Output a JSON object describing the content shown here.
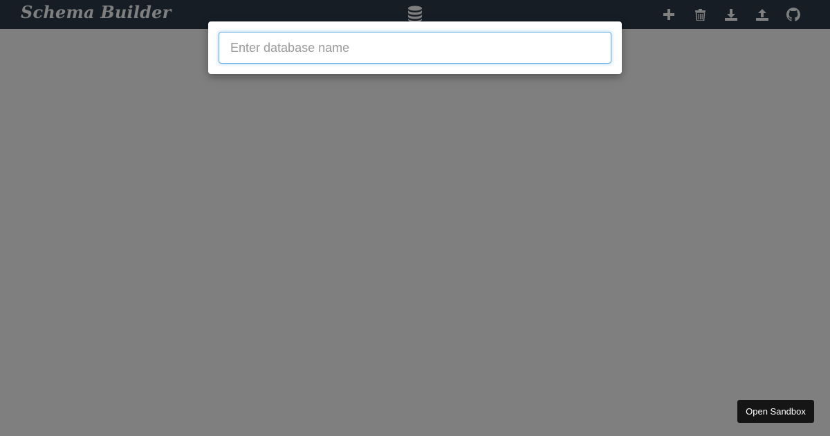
{
  "app": {
    "title": "Schema Builder"
  },
  "toolbar": {
    "center_icon": "database-icon",
    "buttons": [
      {
        "icon": "plus-icon"
      },
      {
        "icon": "trash-icon"
      },
      {
        "icon": "download-icon"
      },
      {
        "icon": "upload-icon"
      },
      {
        "icon": "github-icon"
      }
    ]
  },
  "modal": {
    "input": {
      "value": "",
      "placeholder": "Enter database name"
    }
  },
  "sandbox": {
    "label": "Open Sandbox"
  },
  "colors": {
    "topbar": "#2d3a4b",
    "overlay": "rgba(0,0,0,0.5)",
    "input_focus": "#66afe9",
    "sandbox_bg": "#151515"
  }
}
